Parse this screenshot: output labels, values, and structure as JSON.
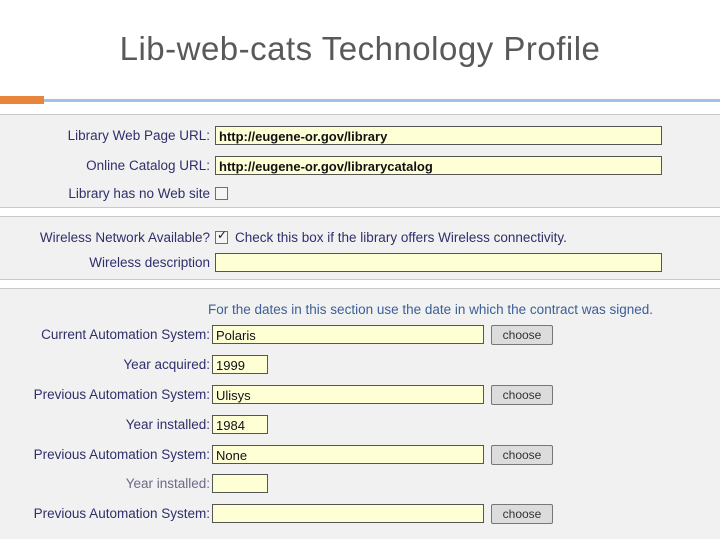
{
  "slide": {
    "title": "Lib-web-cats Technology Profile",
    "accent_color": "#e8853c",
    "rule_color": "#9dc3e6",
    "title_color": "#595959"
  },
  "form": {
    "section1": {
      "fields": [
        {
          "label": "Library Web Page URL:",
          "value": "http://eugene-or.gov/library"
        },
        {
          "label": "Online Catalog URL:",
          "value": "http://eugene-or.gov/librarycatalog"
        }
      ],
      "no_website": {
        "label": "Library has no Web site",
        "checked": false
      }
    },
    "section2": {
      "wireless_available": {
        "label": "Wireless Network Available?",
        "checked": true,
        "hint": "Check this box if the library offers Wireless connectivity."
      },
      "wireless_description": {
        "label": "Wireless description",
        "value": ""
      }
    },
    "section3": {
      "note": "For the dates in this section use the date in which the contract was signed.",
      "choose_label": "choose",
      "rows": [
        {
          "label": "Current Automation System:",
          "value": "Polaris",
          "has_choose": true,
          "wide": true
        },
        {
          "label": "Year acquired:",
          "value": "1999",
          "has_choose": false,
          "wide": false
        },
        {
          "label": "Previous Automation System:",
          "value": "Ulisys",
          "has_choose": true,
          "wide": true
        },
        {
          "label": "Year installed:",
          "value": "1984",
          "has_choose": false,
          "wide": false
        },
        {
          "label": "Previous Automation System:",
          "value": "None",
          "has_choose": true,
          "wide": true
        },
        {
          "label": "Year installed:",
          "value": "",
          "has_choose": false,
          "wide": false
        },
        {
          "label": "Previous Automation System:",
          "value": "",
          "has_choose": true,
          "wide": true
        }
      ]
    }
  }
}
